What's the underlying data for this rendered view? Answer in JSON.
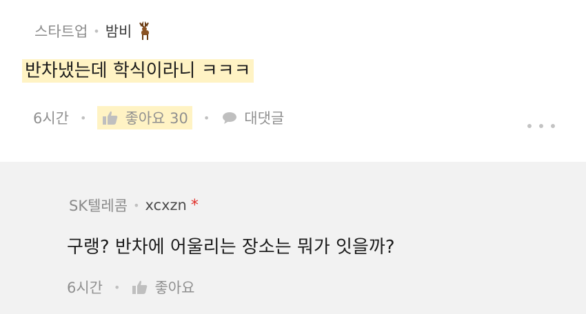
{
  "comment": {
    "company": "스타트업",
    "nickname": "밤비",
    "badge_icon": "deer-icon",
    "text": "반차냈는데 학식이라니 ㅋㅋㅋ",
    "time": "6시간",
    "like_label": "좋아요 30",
    "reply_label": "대댓글",
    "accent_color": "#fff3c4"
  },
  "reply": {
    "company": "SK텔레콤",
    "nickname": "xcxzn",
    "author_mark": "*",
    "text": "구랭? 반차에 어울리는 장소는 뭐가 잇을까?",
    "time": "6시간",
    "like_label": "좋아요"
  }
}
